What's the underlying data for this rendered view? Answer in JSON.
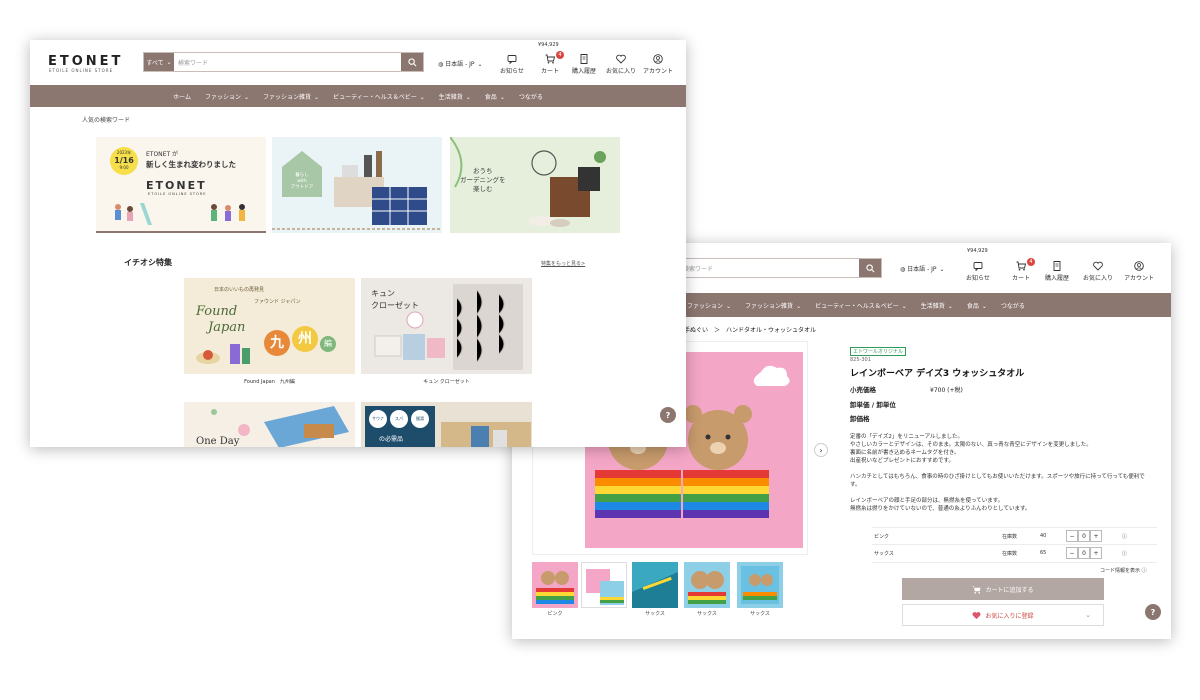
{
  "front": {
    "logo": "ETONET",
    "logo_sub": "ETOILE ONLINE STORE",
    "search": {
      "category": "すべて",
      "placeholder": "検索ワード"
    },
    "language": "日本語 - JP",
    "cart_total": "¥94,929",
    "cart_count": "4",
    "header_icons": {
      "notice": "お知らせ",
      "cart": "カート",
      "history": "購入履歴",
      "favorites": "お気に入り",
      "account": "アカウント"
    },
    "nav": [
      "ホーム",
      "ファッション",
      "ファッション雑貨",
      "ビューティー・ヘルス＆ベビー",
      "生活雑貨",
      "食品",
      "つながる"
    ],
    "popular_label": "人気の検索ワード",
    "banner1": {
      "date_year": "2023年",
      "date": "1/16",
      "date_day": "(月)",
      "date_time": "9:00",
      "line1": "ETONET が",
      "line2": "新しく生まれ変わりました",
      "logo": "ETONET",
      "logo_sub": "ETOILE ONLINE STORE"
    },
    "banner2": {
      "line1": "暮らし",
      "line2": "with",
      "line3": "アウトドア"
    },
    "banner3": {
      "line1": "おうち",
      "line2": "ガーデニングを",
      "line3": "楽しむ"
    },
    "feature_title": "イチオシ特集",
    "feature_more": "特集をもっと見る>",
    "cards": [
      {
        "caption": "Found Japan　九州編",
        "text_top": "日本のいいもの再発見",
        "text_kana": "ファウンド ジャパン",
        "text_en1": "Found",
        "text_en2": "Japan",
        "kanji1": "九",
        "kanji2": "州",
        "kanji3": "編"
      },
      {
        "caption": "キュン クローゼット",
        "text1": "キュン",
        "text2": "クローゼット"
      }
    ],
    "card3_text": "One Day",
    "card4_tags": [
      "サウナ",
      "スパ",
      "銭湯"
    ],
    "card4_sub": "の必需品",
    "help": "?"
  },
  "back": {
    "search_placeholder": "検索ワード",
    "language": "日本語 - JP",
    "cart_total": "¥94,929",
    "cart_count": "4",
    "header_icons": {
      "notice": "お知らせ",
      "cart": "カート",
      "history": "購入履歴",
      "favorites": "お気に入り",
      "account": "アカウント"
    },
    "nav": [
      "ファッション",
      "ファッション雑貨",
      "ビューティー・ヘルス＆ベビー",
      "生活雑貨",
      "食品",
      "つながる"
    ],
    "breadcrumb": "ル・手ぬぐい　＞　ハンドタオル・ウォッシュタオル",
    "product_tag": "エトワールオリジナル",
    "sku": "825-301",
    "title": "レインボーベア デイズ3 ウォッシュタオル",
    "labels": {
      "retail": "小売価格",
      "wholesale_unit": "卸単価 / 卸単位",
      "wholesale": "卸価格"
    },
    "retail_price": "¥700 (+税)",
    "description": [
      "定番の「デイズ2」をリニューアルしました。\nやさしいカラーとデザインは、そのまま。太陽のない、真っ青な青空にデザインを変更しました。\n裏面に名前が書き込めるネームタグを付き。\n出産祝いなどプレゼントにおすすめです。",
      "ハンカチとしてはもちろん、食事の時のひざ掛けとしてもお使いいただけます。スポーツや旅行に持って行っても便利です。",
      "レインボーベアの顔と手足の部分は、無撚糸を使っています。\n無撚糸は撚りをかけていないので、普通の糸よりふんわりとしています。"
    ],
    "variants": [
      {
        "name": "ピンク",
        "stock_label": "在庫数",
        "stock": "40",
        "qty": "0"
      },
      {
        "name": "サックス",
        "stock_label": "在庫数",
        "stock": "65",
        "qty": "0"
      }
    ],
    "stepper": {
      "minus": "−",
      "plus": "+"
    },
    "code_info": "コード情報を表示 ⓘ",
    "cart_button": "カートに追加する",
    "fav_button": "お気に入りに登録",
    "thumb_captions": [
      "ピンク",
      "",
      "サックス",
      "サックス",
      "サックス"
    ],
    "help": "?"
  }
}
